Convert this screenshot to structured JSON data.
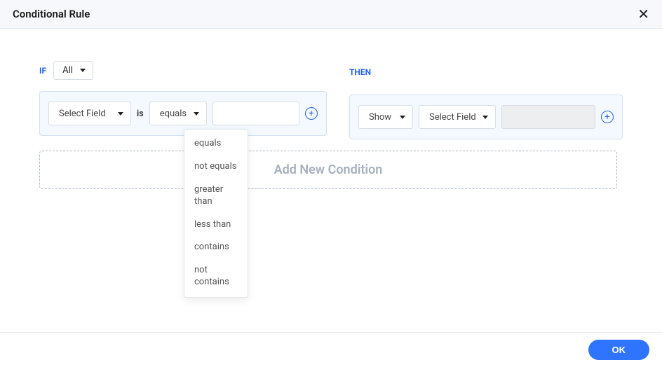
{
  "header": {
    "title": "Conditional Rule"
  },
  "if": {
    "label": "IF",
    "scope": "All",
    "field_placeholder": "Select Field",
    "is_label": "is",
    "operator_selected": "equals",
    "operator_options": [
      "equals",
      "not equals",
      "greater than",
      "less than",
      "contains",
      "not contains"
    ]
  },
  "then": {
    "label": "THEN",
    "action_selected": "Show",
    "field_placeholder": "Select Field"
  },
  "add_new": "Add New Condition",
  "footer": {
    "ok": "OK"
  }
}
